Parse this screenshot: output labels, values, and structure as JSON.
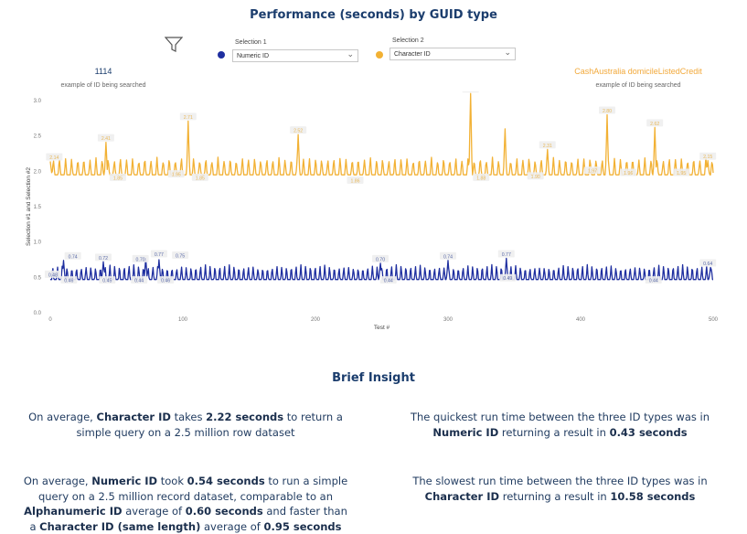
{
  "title": "Performance (seconds) by GUID type",
  "selection1": {
    "label": "Selection 1",
    "value": "Numeric ID",
    "color": "#1f2fa0"
  },
  "selection2": {
    "label": "Selection 2",
    "value": "Character ID",
    "color": "#f2b134"
  },
  "example1": {
    "value": "1114",
    "caption": "example of ID being searched"
  },
  "example2": {
    "value": "CashAustralia domicileListedCredit",
    "caption": "example of ID being searched"
  },
  "chart_data": {
    "type": "line",
    "xlabel": "Test #",
    "ylabel": "Selection #1 and Selection #2",
    "xlim": [
      0,
      500
    ],
    "ylim": [
      0,
      3.0
    ],
    "x_ticks": [
      "0",
      "100",
      "200",
      "300",
      "400",
      "500"
    ],
    "y_ticks": [
      "0.0",
      "0.5",
      "1.0",
      "1.5",
      "2.0",
      "2.5",
      "3.0"
    ],
    "grid": false,
    "series": [
      {
        "name": "Character ID",
        "color": "#f2b134",
        "label_color": "#e8b85a",
        "baseline": 1.95,
        "peak": 2.2,
        "spike_period": 4.6,
        "spikes": [
          [
            0,
            2.14
          ],
          [
            42,
            2.41
          ],
          [
            104,
            2.71
          ],
          [
            187,
            2.52
          ],
          [
            317,
            3.1
          ],
          [
            343,
            2.6
          ],
          [
            375,
            2.31
          ],
          [
            420,
            2.8
          ],
          [
            456,
            2.62
          ],
          [
            496,
            2.15
          ]
        ],
        "labels": [
          {
            "x": 3,
            "y": 2.14,
            "text": "2.14"
          },
          {
            "x": 42,
            "y": 2.41,
            "text": "2.41"
          },
          {
            "x": 51,
            "y": 1.85,
            "text": "1.85"
          },
          {
            "x": 95,
            "y": 1.9,
            "text": "1.95"
          },
          {
            "x": 113,
            "y": 1.85,
            "text": "1.85"
          },
          {
            "x": 104,
            "y": 2.71,
            "text": "2.71"
          },
          {
            "x": 187,
            "y": 2.52,
            "text": "2.52"
          },
          {
            "x": 230,
            "y": 1.81,
            "text": "1.86"
          },
          {
            "x": 317,
            "y": 3.1,
            "text": "3.10"
          },
          {
            "x": 325,
            "y": 1.85,
            "text": "1.88"
          },
          {
            "x": 366,
            "y": 1.87,
            "text": "1.90"
          },
          {
            "x": 375,
            "y": 2.31,
            "text": "2.31"
          },
          {
            "x": 409,
            "y": 1.95,
            "text": "1.97"
          },
          {
            "x": 420,
            "y": 2.8,
            "text": "2.80"
          },
          {
            "x": 436,
            "y": 1.92,
            "text": "1.96"
          },
          {
            "x": 456,
            "y": 2.62,
            "text": "2.62"
          },
          {
            "x": 476,
            "y": 1.92,
            "text": "1.95"
          },
          {
            "x": 496,
            "y": 2.15,
            "text": "2.15"
          }
        ]
      },
      {
        "name": "Numeric ID",
        "color": "#1f2fa0",
        "label_color": "#5a6aa8",
        "baseline": 0.47,
        "peak": 0.68,
        "spike_period": 3.6,
        "spikes": [
          [
            10,
            0.74
          ],
          [
            40,
            0.72
          ],
          [
            72,
            0.77
          ],
          [
            82,
            0.75
          ],
          [
            249,
            0.7
          ],
          [
            300,
            0.74
          ],
          [
            344,
            0.77
          ],
          [
            498,
            0.64
          ]
        ],
        "labels": [
          {
            "x": 2,
            "y": 0.48,
            "text": "0.48"
          },
          {
            "x": 17,
            "y": 0.74,
            "text": "0.74"
          },
          {
            "x": 14,
            "y": 0.4,
            "text": "0.46"
          },
          {
            "x": 40,
            "y": 0.72,
            "text": "0.72"
          },
          {
            "x": 43,
            "y": 0.4,
            "text": "0.45"
          },
          {
            "x": 67,
            "y": 0.4,
            "text": "0.44"
          },
          {
            "x": 68,
            "y": 0.7,
            "text": "0.70"
          },
          {
            "x": 82,
            "y": 0.77,
            "text": "0.77"
          },
          {
            "x": 98,
            "y": 0.75,
            "text": "0.75"
          },
          {
            "x": 87,
            "y": 0.4,
            "text": "0.46"
          },
          {
            "x": 249,
            "y": 0.7,
            "text": "0.70"
          },
          {
            "x": 255,
            "y": 0.4,
            "text": "0.44"
          },
          {
            "x": 300,
            "y": 0.74,
            "text": "0.74"
          },
          {
            "x": 344,
            "y": 0.77,
            "text": "0.77"
          },
          {
            "x": 345,
            "y": 0.43,
            "text": "0.49"
          },
          {
            "x": 455,
            "y": 0.4,
            "text": "0.44"
          },
          {
            "x": 496,
            "y": 0.64,
            "text": "0.64"
          }
        ]
      }
    ]
  },
  "insight": {
    "title": "Brief Insight",
    "p1": {
      "t1": "On average, ",
      "b1": "Character ID",
      "t2": " takes ",
      "b2": "2.22 seconds",
      "t3": " to return a simple query on a 2.5 million row dataset"
    },
    "p2": {
      "t1": "The quickest run time between the three ID types was in ",
      "b1": "Numeric ID",
      "t2": " returning a result in ",
      "b2": "0.43 seconds"
    },
    "p3": {
      "t1": "On average, ",
      "b1": "Numeric ID",
      "t2": " took ",
      "b2": "0.54 seconds",
      "t3": " to run a simple query on a 2.5 million record dataset, comparable to an ",
      "b3": "Alphanumeric ID",
      "t4": " average of ",
      "b4": "0.60 seconds",
      "t5": " and faster than a ",
      "b5": "Character ID (same length)",
      "t6": " average of ",
      "b6": "0.95 seconds"
    },
    "p4": {
      "t1": "The slowest run time between the three ID types was in ",
      "b1": "Character ID",
      "t2": " returning a result in ",
      "b2": "10.58 seconds"
    }
  }
}
